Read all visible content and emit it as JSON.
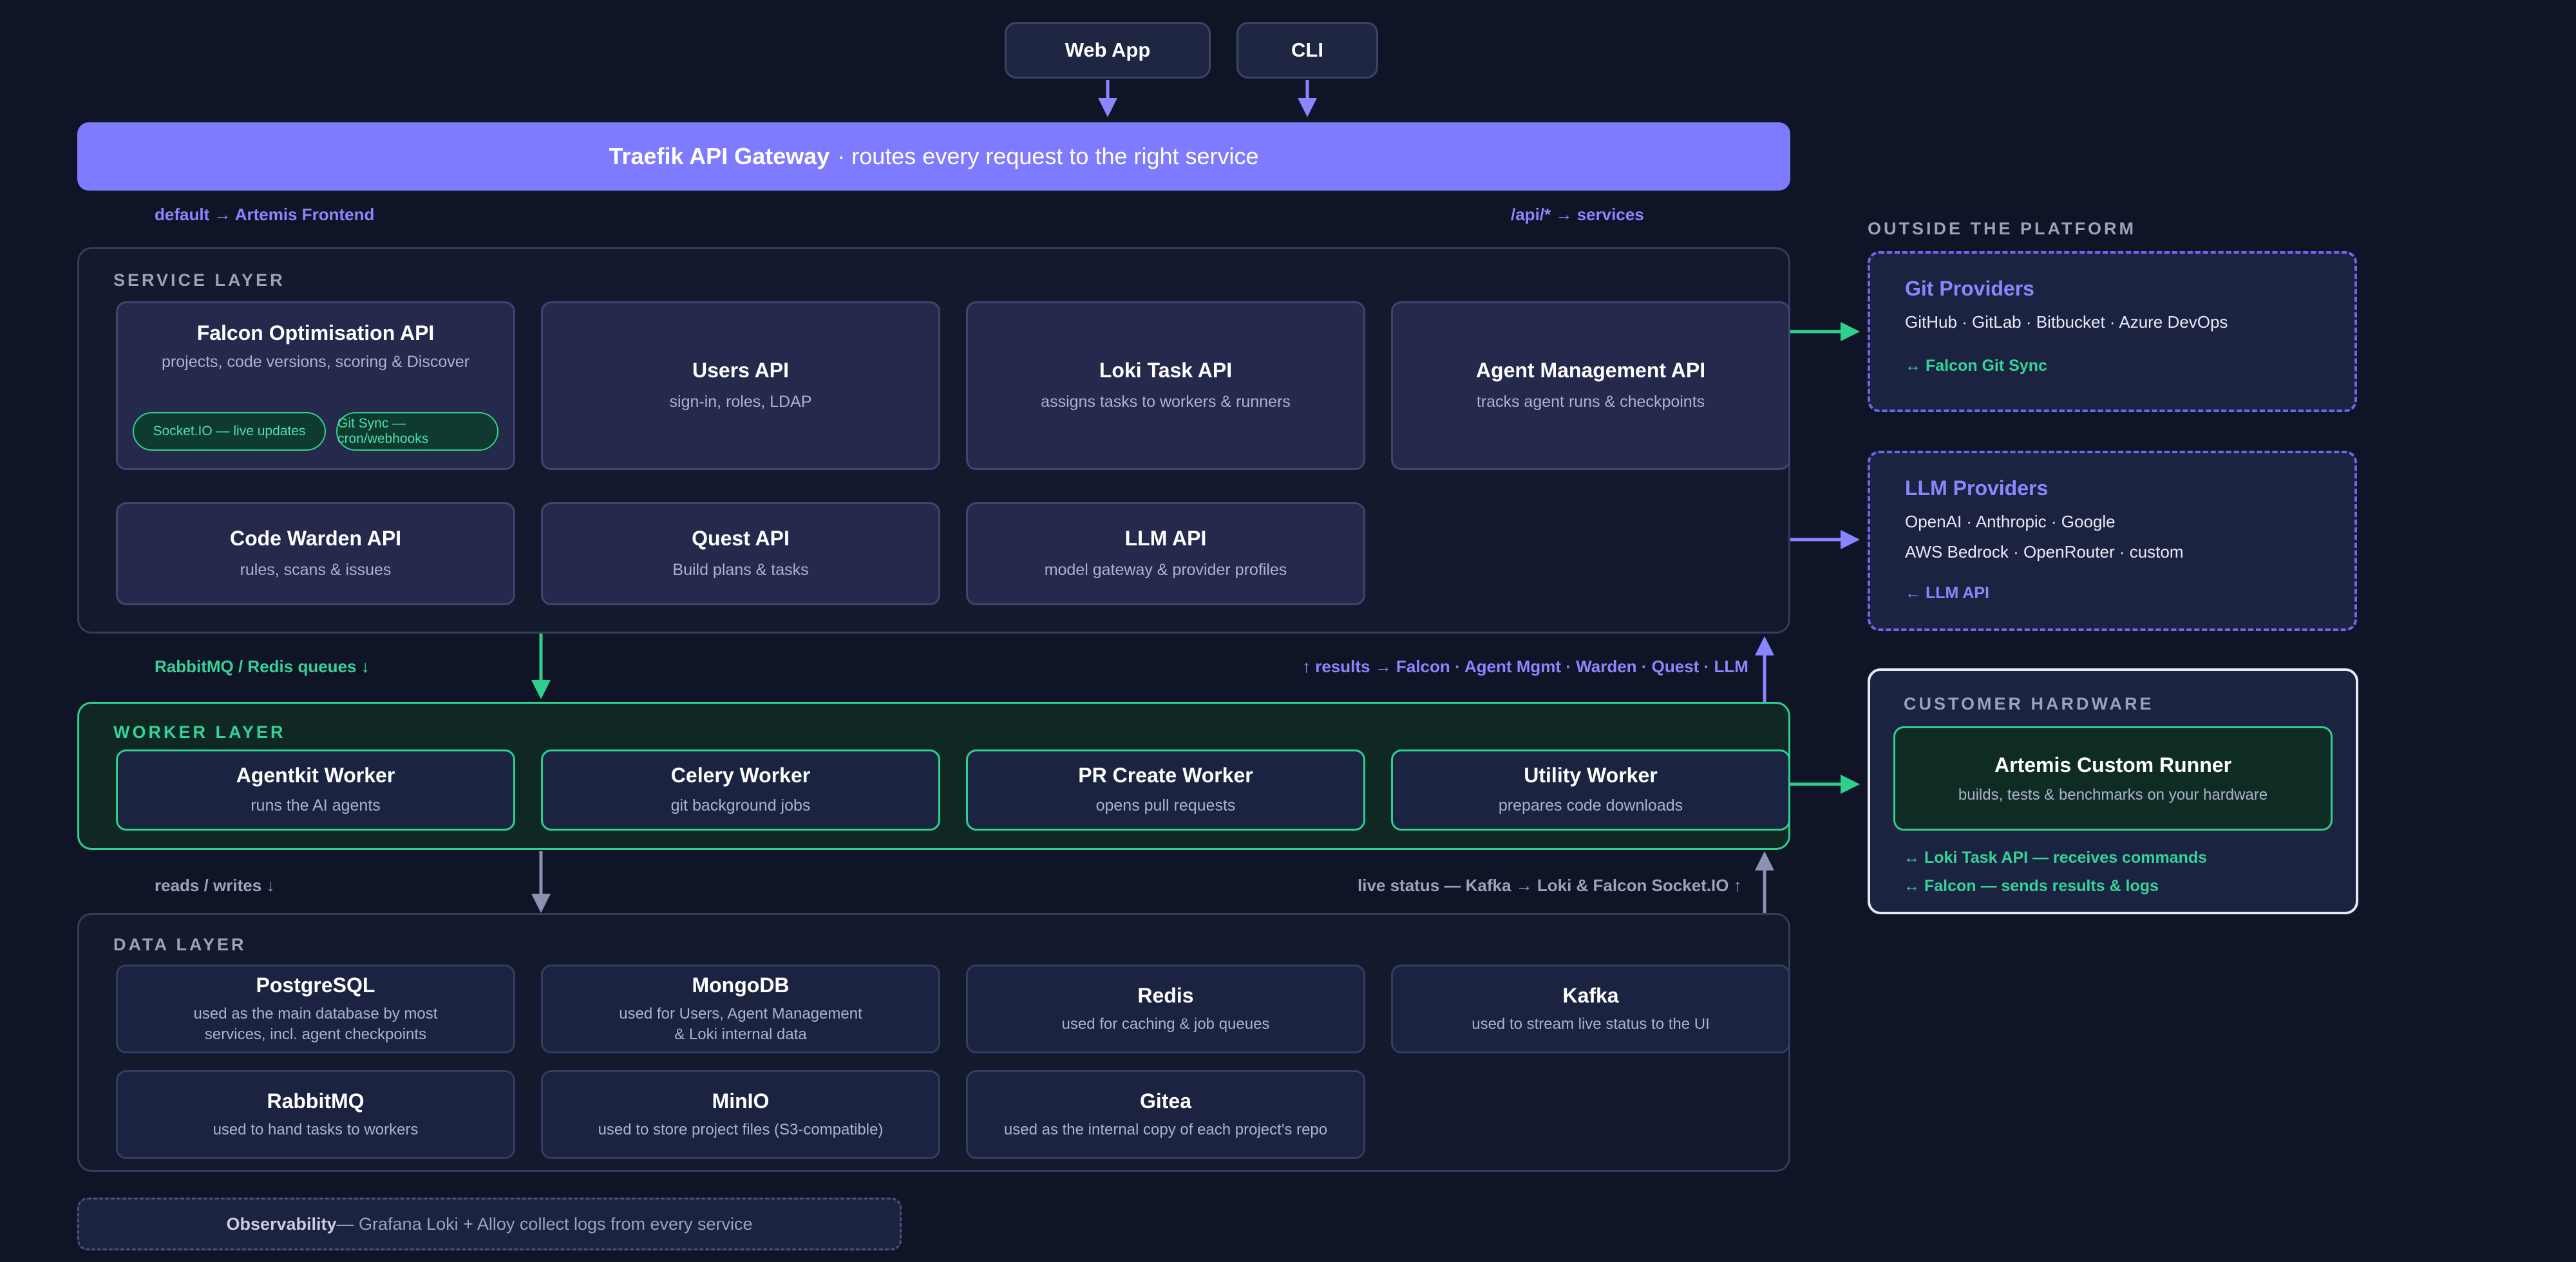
{
  "clients": {
    "web_app": "Web App",
    "cli": "CLI"
  },
  "gateway": {
    "name": "Traefik API Gateway",
    "desc": "· routes every request to the right service"
  },
  "routes": {
    "default": "default → Artemis Frontend",
    "api": "/api/* → services"
  },
  "service_layer": {
    "label": "SERVICE LAYER",
    "cards": [
      {
        "title": "Falcon Optimisation API",
        "sub": "projects, code versions, scoring & Discover"
      },
      {
        "title": "Users API",
        "sub": "sign-in, roles, LDAP"
      },
      {
        "title": "Loki Task API",
        "sub": "assigns tasks to workers & runners"
      },
      {
        "title": "Agent Management API",
        "sub": "tracks agent runs & checkpoints"
      },
      {
        "title": "Code Warden API",
        "sub": "rules, scans & issues"
      },
      {
        "title": "Quest API",
        "sub": "Build plans & tasks"
      },
      {
        "title": "LLM API",
        "sub": "model gateway & provider profiles"
      }
    ],
    "pills": [
      "Socket.IO — live updates",
      "Git Sync — cron/webhooks"
    ]
  },
  "flow_labels": {
    "queues": "RabbitMQ / Redis queues ↓",
    "results": "↑ results → Falcon · Agent Mgmt · Warden · Quest · LLM",
    "reads": "reads / writes ↓",
    "live": "live status — Kafka → Loki & Falcon Socket.IO ↑"
  },
  "worker_layer": {
    "label": "WORKER LAYER",
    "cards": [
      {
        "title": "Agentkit Worker",
        "sub": "runs the AI agents"
      },
      {
        "title": "Celery Worker",
        "sub": "git background jobs"
      },
      {
        "title": "PR Create Worker",
        "sub": "opens pull requests"
      },
      {
        "title": "Utility Worker",
        "sub": "prepares code downloads"
      }
    ]
  },
  "data_layer": {
    "label": "DATA LAYER",
    "cards": [
      {
        "title": "PostgreSQL",
        "sub1": "used as the main database by most",
        "sub2": "services, incl. agent checkpoints"
      },
      {
        "title": "MongoDB",
        "sub1": "used for Users, Agent Management",
        "sub2": "& Loki internal data"
      },
      {
        "title": "Redis",
        "sub1": "used for caching & job queues",
        "sub2": ""
      },
      {
        "title": "Kafka",
        "sub1": "used to stream live status to the UI",
        "sub2": ""
      },
      {
        "title": "RabbitMQ",
        "sub1": "used to hand tasks to workers",
        "sub2": ""
      },
      {
        "title": "MinIO",
        "sub1": "used to store project files (S3-compatible)",
        "sub2": ""
      },
      {
        "title": "Gitea",
        "sub1": "used as the internal copy of each project's repo",
        "sub2": ""
      }
    ]
  },
  "observability": {
    "title": "Observability",
    "desc": " — Grafana Loki + Alloy collect logs from every service"
  },
  "outside": {
    "label": "OUTSIDE THE PLATFORM",
    "git": {
      "title": "Git Providers",
      "list": "GitHub · GitLab · Bitbucket · Azure DevOps",
      "link": "↔ Falcon Git Sync"
    },
    "llm": {
      "title": "LLM Providers",
      "list1": "OpenAI · Anthropic · Google",
      "list2": "AWS Bedrock · OpenRouter · custom",
      "link": "← LLM API"
    }
  },
  "hardware": {
    "label": "CUSTOMER HARDWARE",
    "runner": {
      "title": "Artemis Custom Runner",
      "sub": "builds, tests & benchmarks on your hardware"
    },
    "links": [
      "↔ Loki Task API — receives commands",
      "↔ Falcon — sends results & logs"
    ]
  },
  "colors": {
    "accent_purple": "#7f7bff",
    "accent_green": "#2fd08e",
    "background": "#0f1526"
  }
}
